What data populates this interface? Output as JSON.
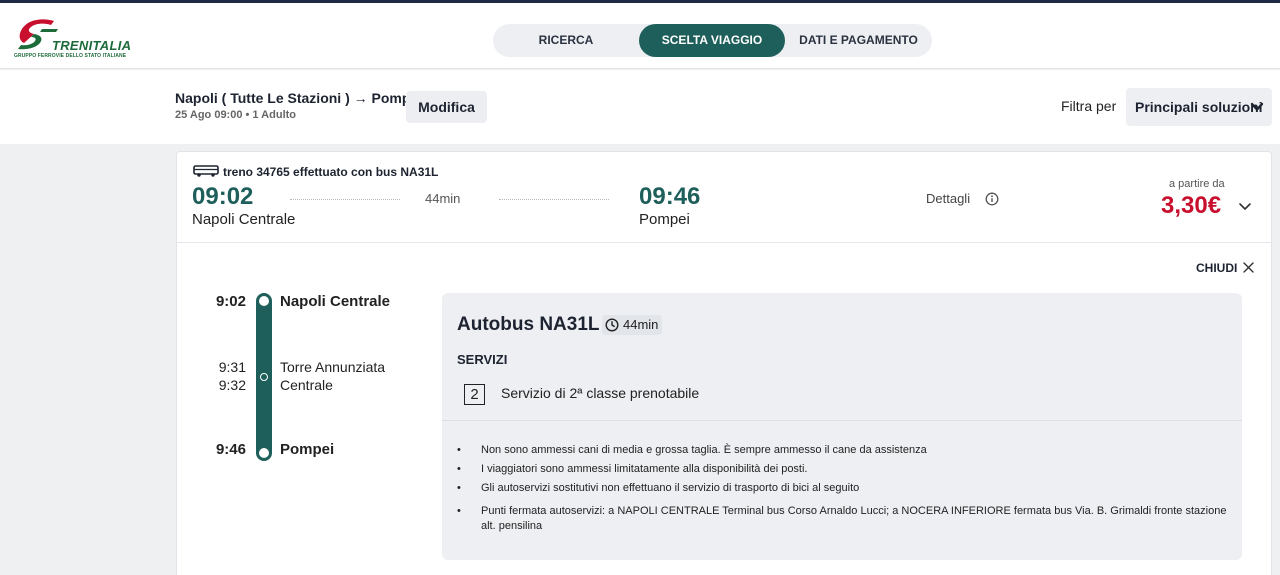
{
  "header": {
    "logo_text": "TRENITALIA",
    "logo_sub": "GRUPPO FERROVIE DELLO STATO ITALIANE",
    "steps": [
      {
        "label": "RICERCA"
      },
      {
        "label": "SCELTA VIAGGIO",
        "active": true
      },
      {
        "label": "DATI E PAGAMENTO"
      }
    ]
  },
  "summary": {
    "route": "Napoli ( Tutte Le Stazioni ) → Pompei",
    "date_info": "25 Ago 09:00 • 1 Adulto",
    "modify_label": "Modifica",
    "filter_label": "Filtra per",
    "filter_value": "Principali soluzioni"
  },
  "solution": {
    "note": "treno 34765 effettuato con bus NA31L",
    "departure_time": "09:02",
    "departure_station": "Napoli Centrale",
    "duration": "44min",
    "arrival_time": "09:46",
    "arrival_station": "Pompei",
    "details_label": "Dettagli",
    "price_label": "a partire da",
    "price": "3,30€",
    "close_label": "CHIUDI"
  },
  "timeline": {
    "stops": [
      {
        "time": "9:02",
        "station": "Napoli Centrale"
      },
      {
        "time_arr": "9:31",
        "time_dep": "9:32",
        "station_line1": "Torre Annunziata",
        "station_line2": "Centrale"
      },
      {
        "time": "9:46",
        "station": "Pompei"
      }
    ]
  },
  "detail": {
    "title": "Autobus NA31L",
    "duration": "44min",
    "services_heading": "SERVIZI",
    "class_number": "2",
    "class_text": "Servizio di 2ª classe prenotabile",
    "notes": [
      "Non sono ammessi cani di media e grossa taglia. È sempre ammesso il cane da assistenza",
      "I viaggiatori sono ammessi limitatamente alla disponibilità dei posti.",
      "Gli autoservizi sostitutivi non effettuano il servizio di trasporto di bici al seguito",
      "Punti fermata autoservizi: a NAPOLI CENTRALE Terminal bus Corso Arnaldo Lucci; a NOCERA INFERIORE fermata bus Via. B. Grimaldi fronte stazione alt. pensilina"
    ]
  },
  "colors": {
    "accent": "#1f5f5b",
    "price": "#c8102e",
    "brand_green": "#1d6b3a",
    "brand_red": "#c8102e"
  }
}
